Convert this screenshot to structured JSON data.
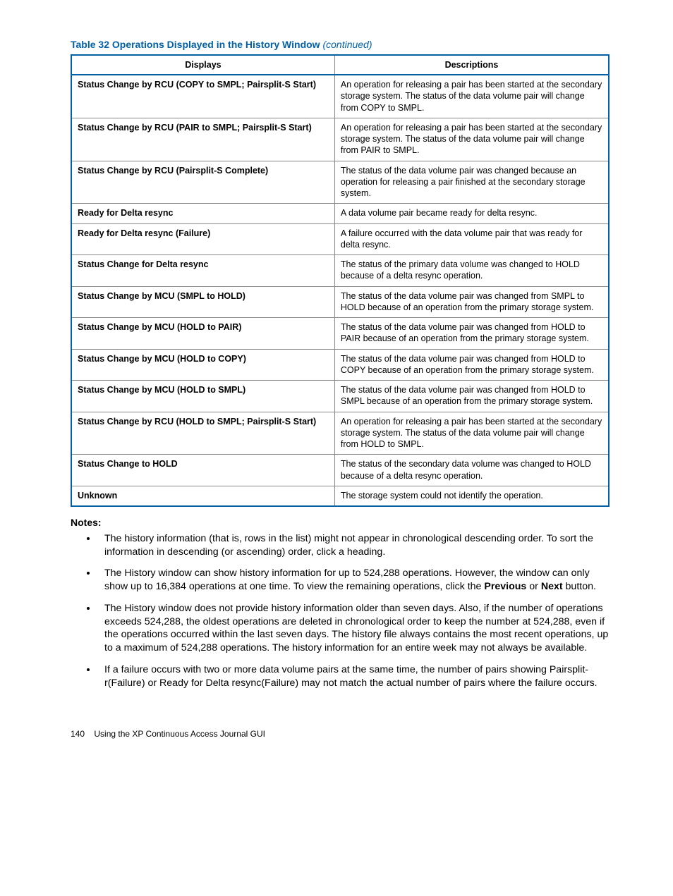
{
  "caption": {
    "main": "Table 32 Operations Displayed in the History Window",
    "cont": "(continued)"
  },
  "headers": {
    "col1": "Displays",
    "col2": "Descriptions"
  },
  "rows": [
    {
      "disp": "Status Change by RCU (COPY to SMPL; Pairsplit-S Start)",
      "desc": "An operation for releasing a pair has been started at the secondary storage system. The status of the data volume pair will change from COPY to SMPL."
    },
    {
      "disp": "Status Change by RCU (PAIR to SMPL; Pairsplit-S Start)",
      "desc": "An operation for releasing a pair has been started at the secondary storage system. The status of the data volume pair will change from PAIR to SMPL."
    },
    {
      "disp": "Status Change by RCU (Pairsplit-S Complete)",
      "desc": "The status of the data volume pair was changed because an operation for releasing a pair finished at the secondary storage system."
    },
    {
      "disp": "Ready for Delta resync",
      "desc": "A data volume pair became ready for delta resync."
    },
    {
      "disp": "Ready for Delta resync (Failure)",
      "desc": "A failure occurred with the data volume pair that was ready for delta resync."
    },
    {
      "disp": "Status Change for Delta resync",
      "desc": "The status of the primary data volume was changed to HOLD because of a delta resync operation."
    },
    {
      "disp": "Status Change by MCU (SMPL to HOLD)",
      "desc": "The status of the data volume pair was changed from SMPL to HOLD because of an operation from the primary storage system."
    },
    {
      "disp": "Status Change by MCU (HOLD to PAIR)",
      "desc": "The status of the data volume pair was changed from HOLD to PAIR because of an operation from the primary storage system."
    },
    {
      "disp": "Status Change by MCU (HOLD to COPY)",
      "desc": "The status of the data volume pair was changed from HOLD to COPY because of an operation from the primary storage system."
    },
    {
      "disp": "Status Change by MCU (HOLD to SMPL)",
      "desc": "The status of the data volume pair was changed from HOLD to SMPL because of an operation from the primary storage system."
    },
    {
      "disp": "Status Change by RCU (HOLD to SMPL; Pairsplit-S Start)",
      "desc": "An operation for releasing a pair has been started at the secondary storage system. The status of the data volume pair will change from HOLD to SMPL."
    },
    {
      "disp": "Status Change to HOLD",
      "desc": "The status of the secondary data volume was changed to HOLD because of a delta resync operation."
    },
    {
      "disp": "Unknown",
      "desc": "The storage system could not identify the operation."
    }
  ],
  "notes_heading": "Notes:",
  "notes": {
    "n1": "The history information (that is, rows in the list) might not appear in chronological descending order. To sort the information in descending (or ascending) order, click a heading.",
    "n2a": "The History window can show history information for up to 524,288 operations. However, the window can only show up to 16,384 operations at one time. To view the remaining operations, click the ",
    "n2_prev": "Previous",
    "n2_or": " or ",
    "n2_next": "Next",
    "n2b": " button.",
    "n3": "The History window does not provide history information older than seven days. Also, if the number of operations exceeds 524,288, the oldest operations are deleted in chronological order to keep the number at 524,288, even if the operations occurred within the last seven days. The history file always contains the most recent operations, up to a maximum of 524,288 operations. The history information for an entire week may not always be available.",
    "n4": "If a failure occurs with two or more data volume pairs at the same time, the number of pairs showing Pairsplit-r(Failure) or Ready for Delta resync(Failure) may not match the actual number of pairs where the failure occurs."
  },
  "footer": {
    "page": "140",
    "title": "Using the XP Continuous Access Journal GUI"
  }
}
